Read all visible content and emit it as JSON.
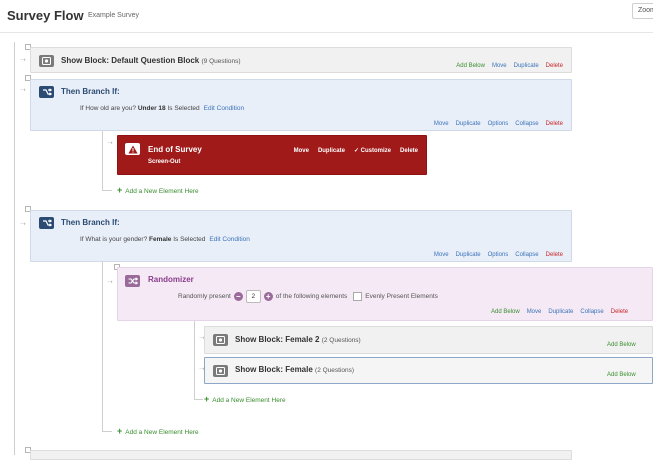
{
  "header": {
    "title": "Survey Flow",
    "survey_name": "Example Survey",
    "zoom_label": "Zoom"
  },
  "blocks": {
    "default": {
      "label": "Show Block: Default Question Block",
      "qcount": "(9 Questions)",
      "actions": [
        "Add Below",
        "Move",
        "Duplicate",
        "Delete"
      ]
    },
    "female2": {
      "label": "Show Block: Female 2",
      "qcount": "(2 Questions)",
      "actions": [
        "Add Below"
      ]
    },
    "female": {
      "label": "Show Block: Female",
      "qcount": "(2 Questions)",
      "actions": [
        "Add Below"
      ]
    }
  },
  "branch1": {
    "title": "Then Branch If:",
    "cond_prefix": "If How old are you?",
    "cond_value": "Under 18",
    "cond_suffix": "Is Selected",
    "edit_label": "Edit Condition",
    "actions": [
      "Move",
      "Duplicate",
      "Options",
      "Collapse",
      "Delete"
    ]
  },
  "end_of_survey": {
    "title": "End of Survey",
    "subtitle": "Screen-Out",
    "actions": [
      "Move",
      "Duplicate",
      "✓ Customize",
      "Delete"
    ]
  },
  "branch2": {
    "title": "Then Branch If:",
    "cond_prefix": "If What is your gender?",
    "cond_value": "Female",
    "cond_suffix": "Is Selected",
    "edit_label": "Edit Condition",
    "actions": [
      "Move",
      "Duplicate",
      "Options",
      "Collapse",
      "Delete"
    ]
  },
  "randomizer": {
    "title": "Randomizer",
    "prefix": "Randomly present",
    "count": "2",
    "suffix": "of the following elements",
    "evenly_label": "Evenly Present Elements",
    "actions": [
      "Add Below",
      "Move",
      "Duplicate",
      "Collapse",
      "Delete"
    ]
  },
  "add_element_label": "Add a New Element Here",
  "icons": {
    "block": "block-icon",
    "branch": "branch-icon",
    "randomizer": "shuffle-icon",
    "end_of_survey": "warning-icon"
  },
  "colors": {
    "add_green": "#3a8d2f",
    "link_blue": "#3b73b9",
    "delete_red": "#c62828",
    "end_survey_red": "#a11a1a",
    "branch_navy": "#2b4b73",
    "randomizer_purple": "#8b3e8b"
  }
}
